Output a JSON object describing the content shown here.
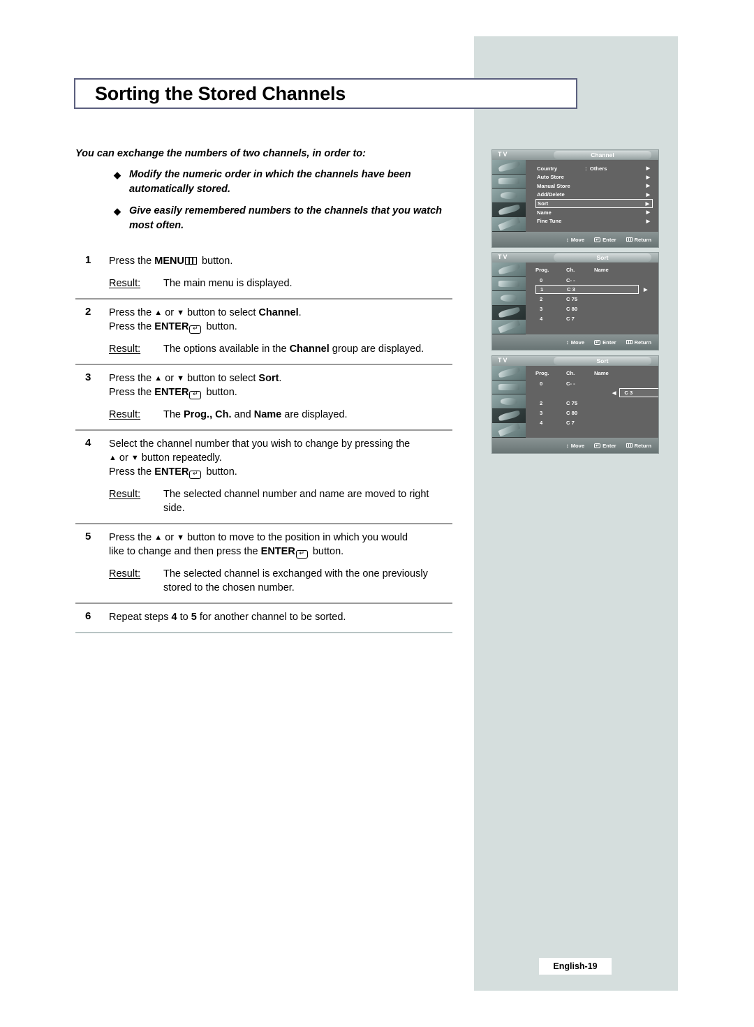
{
  "page": {
    "title": "Sorting the Stored Channels",
    "footer": "English-19"
  },
  "intro": {
    "lead": "You can exchange the numbers of two channels, in order to:",
    "bullet_glyph": "◆",
    "bullets": [
      "Modify the numeric order in which the channels have been automatically stored.",
      "Give easily remembered numbers to the channels that you watch most often."
    ]
  },
  "steps": [
    {
      "num": "1",
      "line1_a": "Press the ",
      "line1_menu": "MENU",
      "line1_b": " button.",
      "result_label": "Result",
      "result_text": "The main menu is displayed."
    },
    {
      "num": "2",
      "line1_a": "Press the ",
      "up": "▲",
      "or": " or ",
      "down": "▼",
      "line1_b": " button to select ",
      "line1_bold": "Channel",
      "line1_c": ".",
      "line2_a": "Press the ",
      "line2_enter": "ENTER",
      "line2_b": " button.",
      "result_label": "Result",
      "result_a": "The options available in the ",
      "result_bold": "Channel",
      "result_b": " group are displayed."
    },
    {
      "num": "3",
      "line1_a": "Press the ",
      "line1_b": " button to select ",
      "line1_bold": "Sort",
      "line1_c": ".",
      "line2_a": "Press the ",
      "line2_enter": "ENTER",
      "line2_b": " button.",
      "result_label": "Result",
      "result_a": "The ",
      "result_bold1": "Prog., Ch.",
      "result_mid": " and ",
      "result_bold2": "Name",
      "result_b": " are displayed."
    },
    {
      "num": "4",
      "line1": "Select the channel number that you wish to change by pressing the",
      "line2_b": " button repeatedly.",
      "line3_a": "Press the ",
      "line3_enter": "ENTER",
      "line3_b": " button.",
      "result_label": "Result",
      "result_text": "The selected channel number and name are moved to right side."
    },
    {
      "num": "5",
      "line1_a": "Press the ",
      "line1_b": " button to move to the position in which you would",
      "line2_a": "like to change and then press the ",
      "line2_enter": "ENTER",
      "line2_b": " button.",
      "result_label": "Result",
      "result_text": "The selected channel is exchanged with the one previously stored to the chosen number."
    },
    {
      "num": "6",
      "line1_a": "Repeat steps ",
      "line1_b1": "4",
      "line1_mid": " to ",
      "line1_b2": "5",
      "line1_c": " for another channel to be sorted."
    }
  ],
  "osd": {
    "tv_label": "TV",
    "footer_items": [
      {
        "glyph": "move",
        "label": "Move"
      },
      {
        "glyph": "enter",
        "label": "Enter"
      },
      {
        "glyph": "return",
        "label": "Return"
      }
    ],
    "panel1": {
      "title": "Channel",
      "rows": [
        {
          "label": "Country",
          "sep": ":",
          "value": "Others",
          "arrow": "▶",
          "selected": false
        },
        {
          "label": "Auto Store",
          "sep": "",
          "value": "",
          "arrow": "▶",
          "selected": false
        },
        {
          "label": "Manual Store",
          "sep": "",
          "value": "",
          "arrow": "▶",
          "selected": false
        },
        {
          "label": "Add/Delete",
          "sep": "",
          "value": "",
          "arrow": "▶",
          "selected": false
        },
        {
          "label": "Sort",
          "sep": "",
          "value": "",
          "arrow": "▶",
          "selected": true
        },
        {
          "label": "Name",
          "sep": "",
          "value": "",
          "arrow": "▶",
          "selected": false
        },
        {
          "label": "Fine Tune",
          "sep": "",
          "value": "",
          "arrow": "▶",
          "selected": false
        }
      ]
    },
    "panel2": {
      "title": "Sort",
      "headers": [
        "Prog.",
        "Ch.",
        "Name"
      ],
      "rows": [
        {
          "prog": "0",
          "ch": "C- -",
          "name": "",
          "selected": false,
          "arrow": ""
        },
        {
          "prog": "1",
          "ch": "C 3",
          "name": "",
          "selected": true,
          "arrow": "▶"
        },
        {
          "prog": "2",
          "ch": "C 75",
          "name": "",
          "selected": false,
          "arrow": ""
        },
        {
          "prog": "3",
          "ch": "C 80",
          "name": "",
          "selected": false,
          "arrow": ""
        },
        {
          "prog": "4",
          "ch": "C 7",
          "name": "",
          "selected": false,
          "arrow": ""
        }
      ]
    },
    "panel3": {
      "title": "Sort",
      "headers": [
        "Prog.",
        "Ch.",
        "Name"
      ],
      "rows": [
        {
          "prog": "0",
          "ch": "C- -",
          "name": "",
          "moved": false
        },
        {
          "prog": "",
          "ch": "",
          "name": "",
          "moved": true,
          "moved_arrow": "◀",
          "moved_value": "C 3"
        },
        {
          "prog": "2",
          "ch": "C 75",
          "name": "",
          "moved": false
        },
        {
          "prog": "3",
          "ch": "C 80",
          "name": "",
          "moved": false
        },
        {
          "prog": "4",
          "ch": "C 7",
          "name": "",
          "moved": false
        }
      ]
    }
  },
  "colors": {
    "band": "#d5dedd",
    "title_border": "#5b5f7e",
    "osd_body": "#636363",
    "rule": "#9a9a9a"
  }
}
